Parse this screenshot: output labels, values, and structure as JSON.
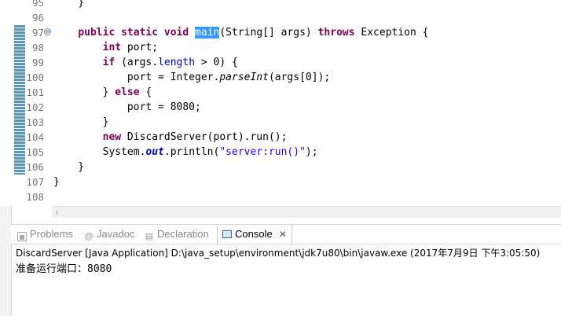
{
  "editor": {
    "lines": [
      {
        "n": "95",
        "code": "    }"
      },
      {
        "n": "96",
        "code": ""
      },
      {
        "n": "97",
        "code": "    public static void main(String[] args) throws Exception {"
      },
      {
        "n": "98",
        "code": "        int port;"
      },
      {
        "n": "99",
        "code": "        if (args.length > 0) {"
      },
      {
        "n": "100",
        "code": "            port = Integer.parseInt(args[0]);"
      },
      {
        "n": "101",
        "code": "        } else {"
      },
      {
        "n": "102",
        "code": "            port = 8080;"
      },
      {
        "n": "103",
        "code": "        }"
      },
      {
        "n": "104",
        "code": "        new DiscardServer(port).run();"
      },
      {
        "n": "105",
        "code": "        System.out.println(\"server:run()\");"
      },
      {
        "n": "106",
        "code": "    }"
      },
      {
        "n": "107",
        "code": "}"
      },
      {
        "n": "108",
        "code": ""
      }
    ],
    "fold_marker": "⊖"
  },
  "tabs": {
    "problems": "Problems",
    "javadoc": "Javadoc",
    "declaration": "Declaration",
    "console": "Console"
  },
  "console": {
    "title": "DiscardServer [Java Application] D:\\java_setup\\environment\\jdk7u80\\bin\\javaw.exe (2017年7月9日 下午3:05:50)",
    "output": "准备运行端口：8080"
  },
  "colors": {
    "keyword": "#7f0055",
    "field": "#0000c0",
    "string": "#2a00ff",
    "selection": "#3399ff"
  }
}
